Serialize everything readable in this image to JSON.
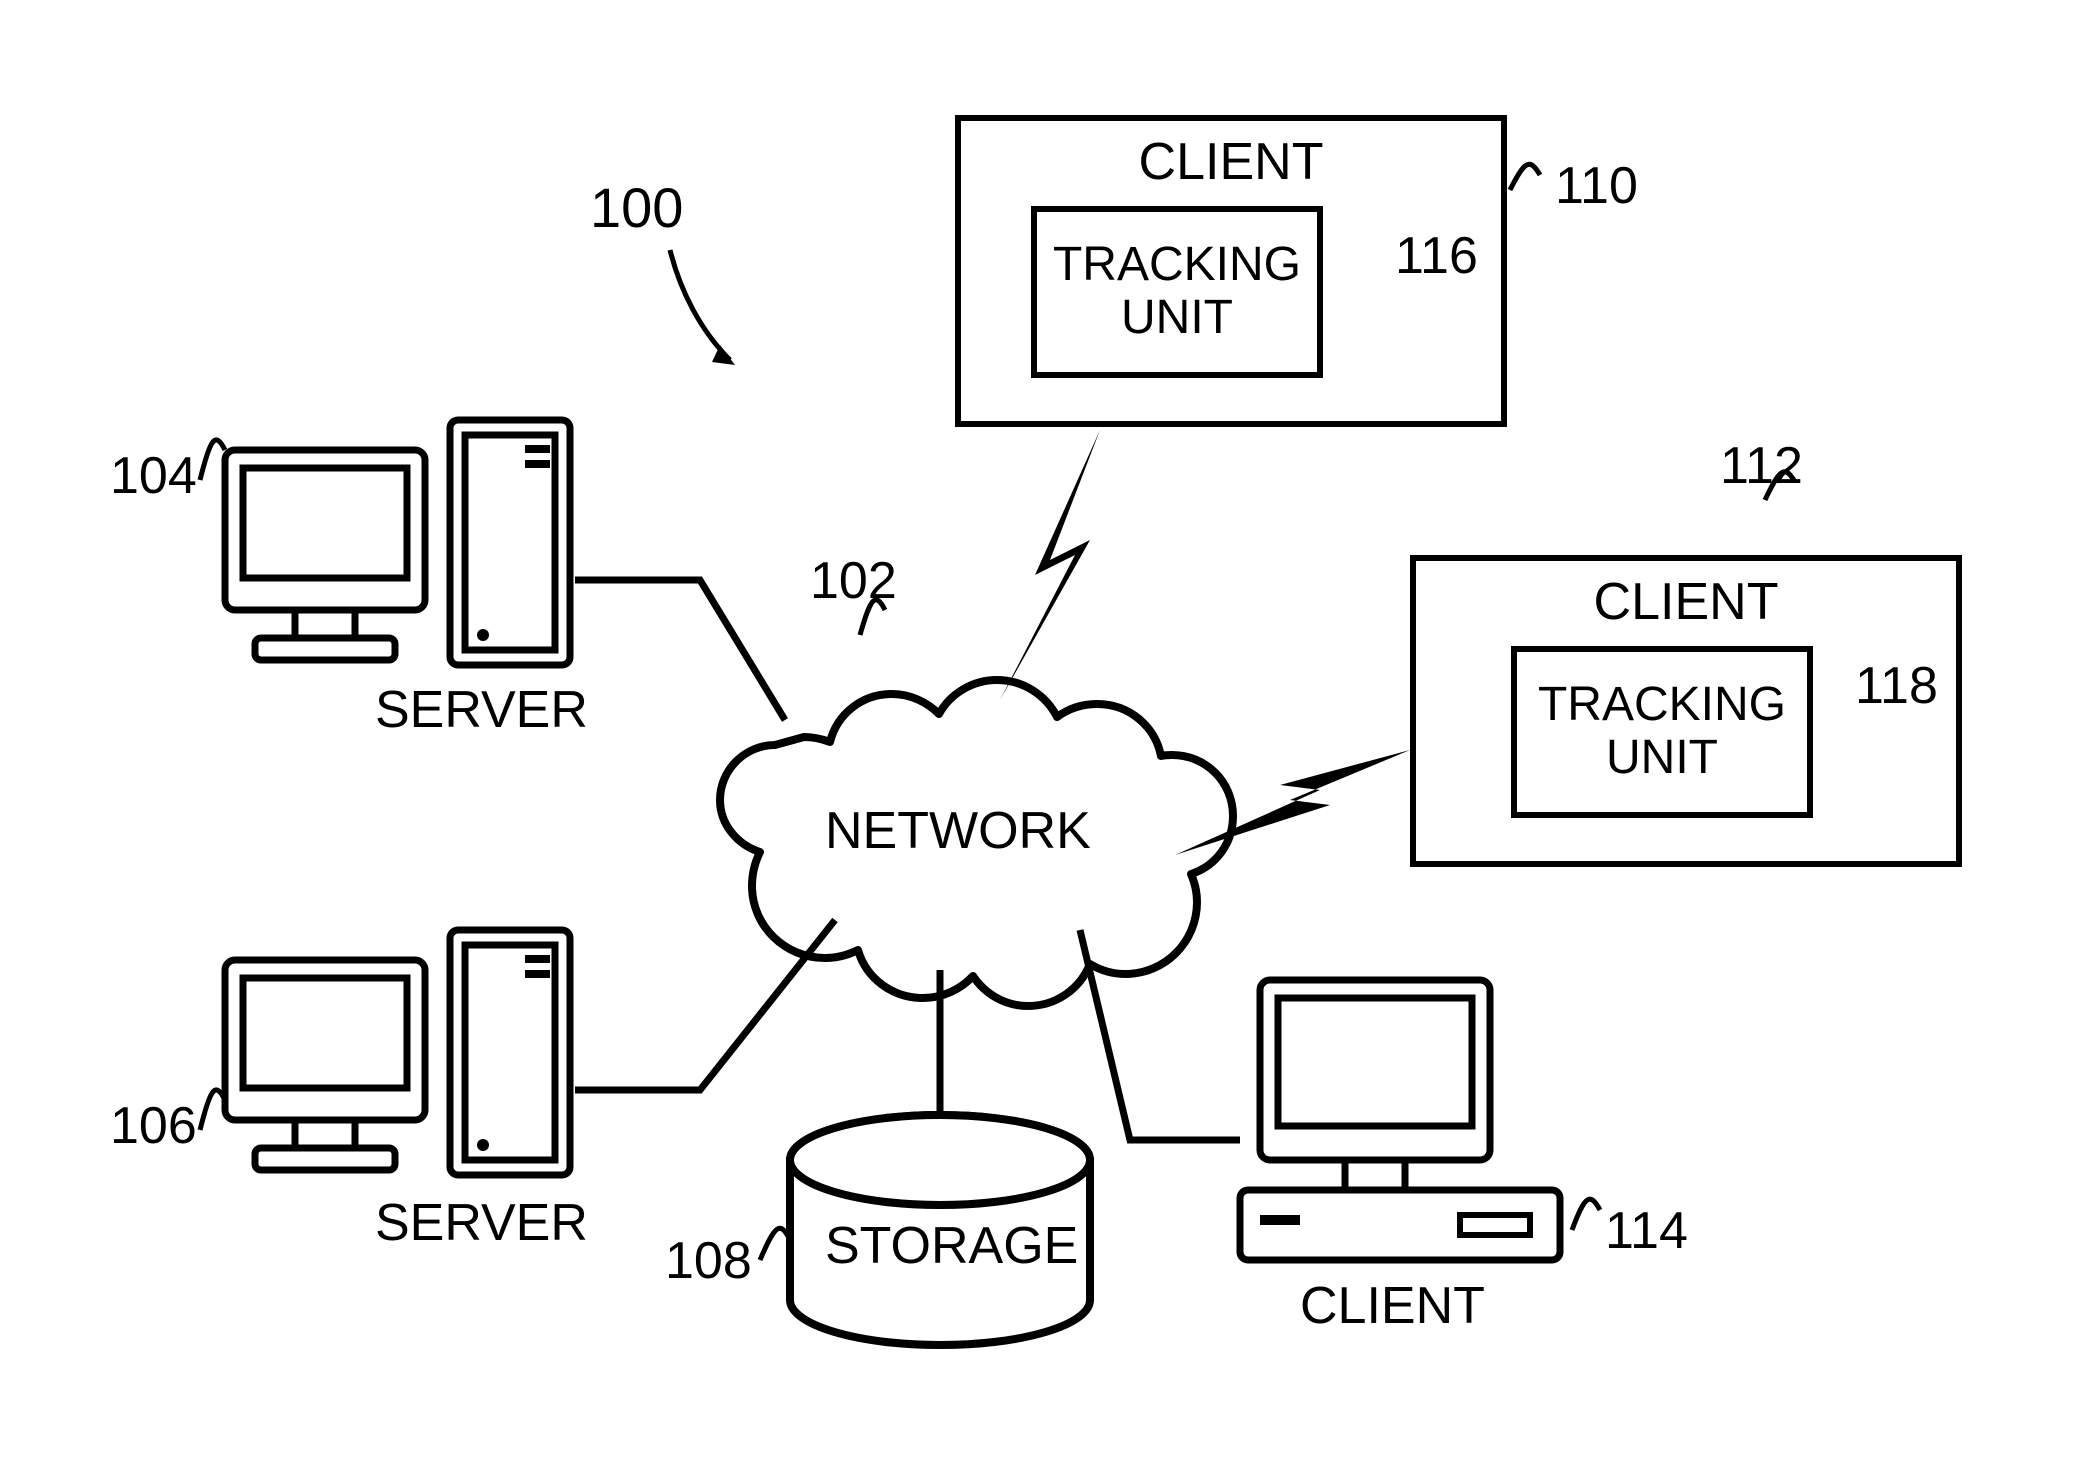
{
  "figure_ref_main": "100",
  "network": {
    "label": "NETWORK",
    "ref": "102"
  },
  "servers": [
    {
      "label": "SERVER",
      "ref": "104"
    },
    {
      "label": "SERVER",
      "ref": "106"
    }
  ],
  "storage": {
    "label": "STORAGE",
    "ref": "108"
  },
  "clients": [
    {
      "label": "CLIENT",
      "ref": "110",
      "tracking_unit": {
        "label": "TRACKING\nUNIT",
        "ref": "116"
      }
    },
    {
      "label": "CLIENT",
      "ref": "112",
      "tracking_unit": {
        "label": "TRACKING\nUNIT",
        "ref": "118"
      }
    },
    {
      "label": "CLIENT",
      "ref": "114"
    }
  ]
}
